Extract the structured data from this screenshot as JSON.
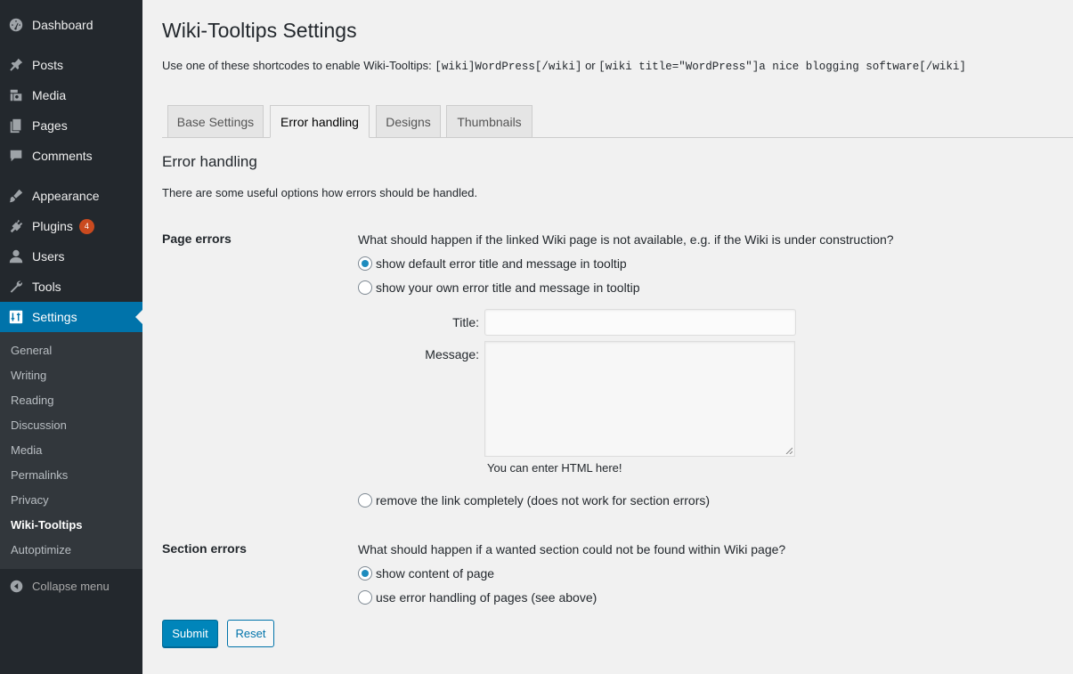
{
  "sidebar": {
    "items": [
      {
        "label": "Dashboard",
        "icon": "dashboard-icon"
      },
      {
        "label": "Posts",
        "icon": "pin-icon"
      },
      {
        "label": "Media",
        "icon": "media-icon"
      },
      {
        "label": "Pages",
        "icon": "pages-icon"
      },
      {
        "label": "Comments",
        "icon": "comments-icon"
      },
      {
        "label": "Appearance",
        "icon": "brush-icon"
      },
      {
        "label": "Plugins",
        "icon": "plugin-icon",
        "badge": "4"
      },
      {
        "label": "Users",
        "icon": "users-icon"
      },
      {
        "label": "Tools",
        "icon": "wrench-icon"
      },
      {
        "label": "Settings",
        "icon": "settings-icon",
        "current": true
      }
    ],
    "submenu": [
      "General",
      "Writing",
      "Reading",
      "Discussion",
      "Media",
      "Permalinks",
      "Privacy",
      "Wiki-Tooltips",
      "Autoptimize"
    ],
    "submenu_current": "Wiki-Tooltips",
    "collapse_label": "Collapse menu"
  },
  "page": {
    "title": "Wiki-Tooltips Settings",
    "intro_text": "Use one of these shortcodes to enable Wiki-Tooltips:",
    "shortcode_1": "[wiki]WordPress[/wiki]",
    "intro_or": "or",
    "shortcode_2": "[wiki title=\"WordPress\"]a nice blogging software[/wiki]"
  },
  "tabs": [
    "Base Settings",
    "Error handling",
    "Designs",
    "Thumbnails"
  ],
  "active_tab": "Error handling",
  "section": {
    "heading": "Error handling",
    "description": "There are some useful options how errors should be handled."
  },
  "page_errors": {
    "label": "Page errors",
    "question": "What should happen if the linked Wiki page is not available, e.g. if the Wiki is under construction?",
    "options": [
      {
        "label": "show default error title and message in tooltip",
        "checked": true
      },
      {
        "label": "show your own error title and message in tooltip",
        "checked": false
      },
      {
        "label": "remove the link completely (does not work for section errors)",
        "checked": false
      }
    ],
    "title_label": "Title:",
    "title_value": "",
    "message_label": "Message:",
    "message_value": "",
    "hint": "You can enter HTML here!"
  },
  "section_errors": {
    "label": "Section errors",
    "question": "What should happen if a wanted section could not be found within Wiki page?",
    "options": [
      {
        "label": "show content of page",
        "checked": true
      },
      {
        "label": "use error handling of pages (see above)",
        "checked": false
      }
    ]
  },
  "buttons": {
    "submit": "Submit",
    "reset": "Reset"
  },
  "colors": {
    "sidebar_bg": "#23282d",
    "accent": "#0073aa",
    "badge": "#ca4a1f",
    "primary_button": "#0085ba"
  }
}
